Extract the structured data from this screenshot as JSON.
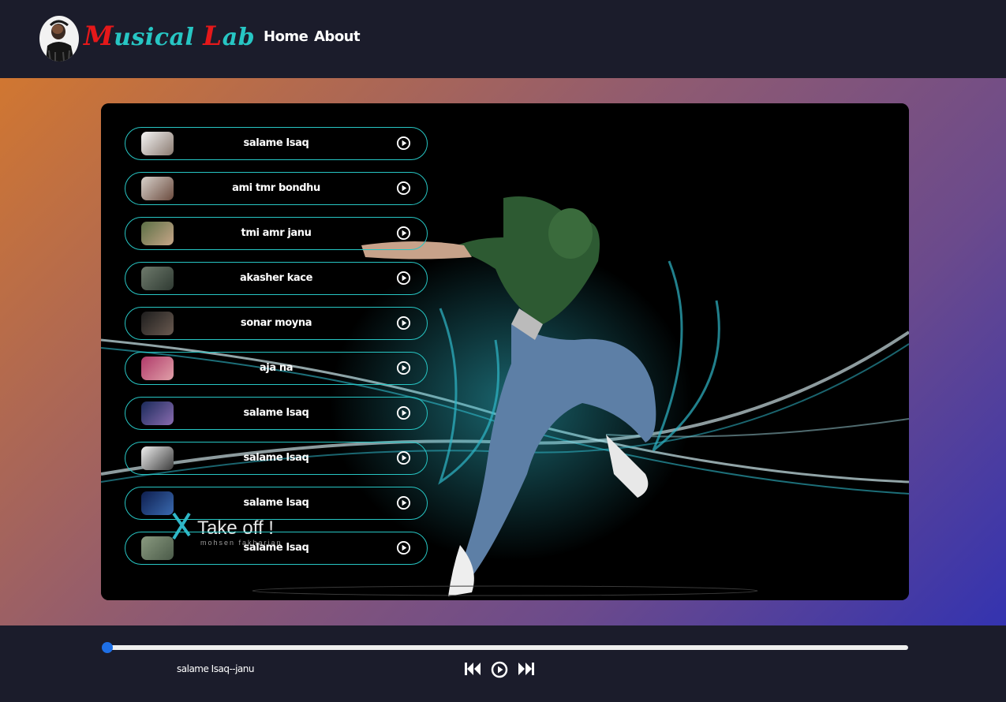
{
  "brand": {
    "name_first_cap": "M",
    "name_first_rest": "usical ",
    "name_second_cap": "L",
    "name_second_rest": "ab"
  },
  "nav": [
    {
      "label": "Home"
    },
    {
      "label": "About"
    }
  ],
  "songs": [
    {
      "title": "salame Isaq"
    },
    {
      "title": "ami tmr bondhu"
    },
    {
      "title": "tmi amr janu"
    },
    {
      "title": "akasher kace"
    },
    {
      "title": "sonar moyna"
    },
    {
      "title": "aja na"
    },
    {
      "title": "salame Isaq"
    },
    {
      "title": "salame Isaq"
    },
    {
      "title": "salame Isaq"
    },
    {
      "title": "salame Isaq"
    }
  ],
  "artwork": {
    "caption": "Take off !",
    "credit": "mohsen fakharian"
  },
  "player": {
    "now_playing": "salame Isaq--janu",
    "progress": 0
  },
  "icons": {
    "play": "play-circle-icon",
    "prev": "previous-icon",
    "next": "next-icon"
  },
  "colors": {
    "accent": "#27c6c4",
    "brand_red": "#e5181a",
    "bar_bg": "#1b1c2b",
    "slider": "#1e6fe6"
  }
}
